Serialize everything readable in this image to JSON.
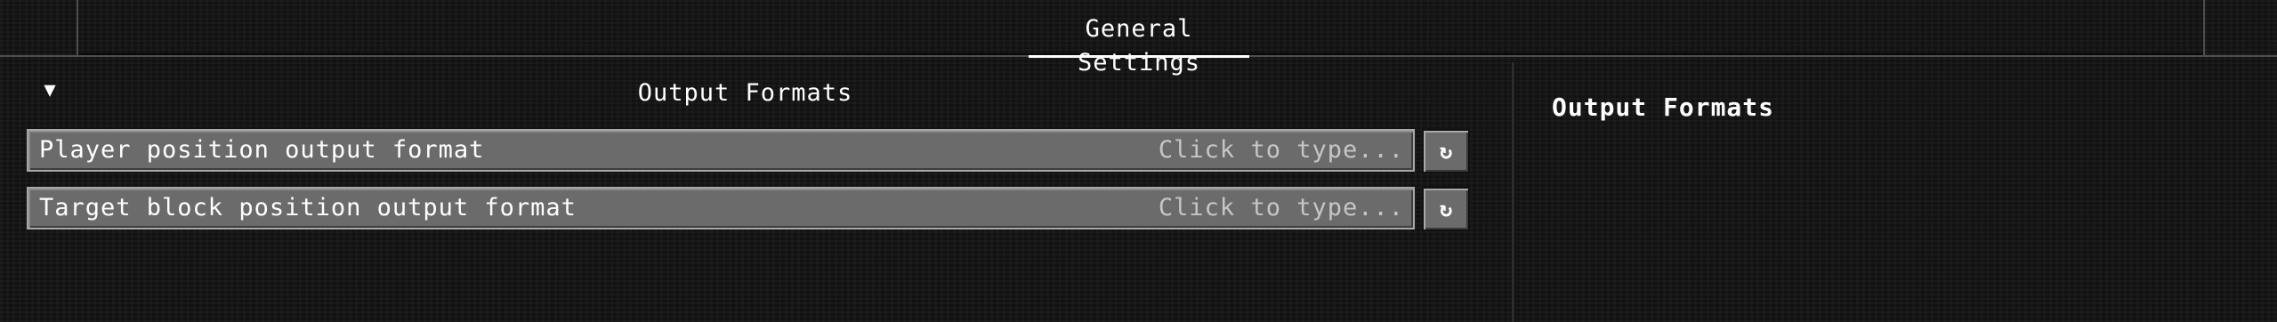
{
  "header": {
    "active_tab_label": "General Settings"
  },
  "options": {
    "section_toggle_glyph": "▼",
    "section_title": "Output Formats",
    "rows": [
      {
        "label": "Player position output format",
        "placeholder": "Click to type...",
        "reset_glyph": "↻"
      },
      {
        "label": "Target block position output format",
        "placeholder": "Click to type...",
        "reset_glyph": "↻"
      }
    ]
  },
  "description": {
    "title": "Output Formats"
  },
  "icons": {
    "collapse": "chevron-down-icon",
    "reset": "reset-icon"
  },
  "colors": {
    "background": "#131313",
    "field_fill": "#6b6b6b",
    "field_border": "#a8a8a8",
    "text": "#ffffff",
    "placeholder_text": "#c6c6c6"
  }
}
